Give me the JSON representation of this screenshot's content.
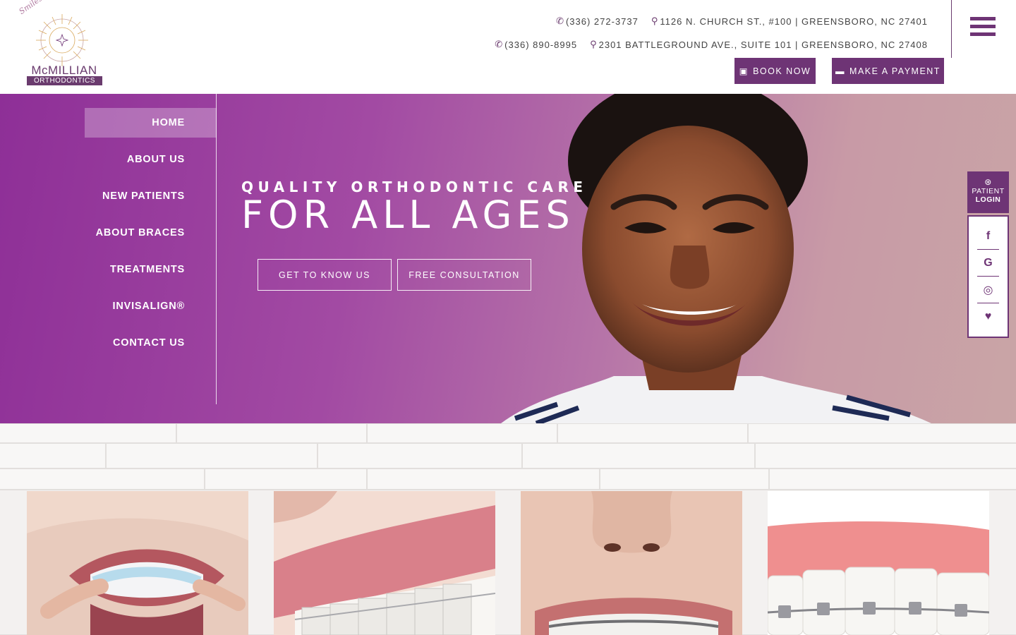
{
  "brand": {
    "tagline": "Smiles for all ages",
    "name": "McMILLIAN",
    "subname": "ORTHODONTICS",
    "accent_color": "#6e3475"
  },
  "contact": {
    "row1": {
      "phone": "(336) 272-3737",
      "address": "1126 N. CHURCH ST., #100 | GREENSBORO, NC 27401"
    },
    "row2": {
      "phone": "(336) 890-8995",
      "address": "2301 BATTLEGROUND AVE., SUITE 101 | GREENSBORO, NC 27408"
    }
  },
  "buttons": {
    "book_now": "BOOK NOW",
    "make_payment": "MAKE A PAYMENT"
  },
  "nav": {
    "items": [
      {
        "label": "HOME",
        "active": true
      },
      {
        "label": "ABOUT US"
      },
      {
        "label": "NEW PATIENTS"
      },
      {
        "label": "ABOUT BRACES"
      },
      {
        "label": "TREATMENTS"
      },
      {
        "label": "INVISALIGN®"
      },
      {
        "label": "CONTACT US"
      }
    ]
  },
  "hero": {
    "eyebrow": "QUALITY ORTHODONTIC CARE",
    "headline": "FOR ALL AGES",
    "cta_primary": "GET TO KNOW US",
    "cta_secondary": "FREE CONSULTATION"
  },
  "patient_login": {
    "line1": "PATIENT",
    "line2": "LOGIN",
    "icon": "user-circle-icon"
  },
  "social": [
    {
      "name": "facebook",
      "glyph": "f"
    },
    {
      "name": "google",
      "glyph": "G"
    },
    {
      "name": "instagram",
      "glyph": "◎"
    },
    {
      "name": "healthgrades",
      "glyph": "♥"
    }
  ],
  "cards": [
    {
      "subject": "clear aligner"
    },
    {
      "subject": "ceramic braces"
    },
    {
      "subject": "metal braces"
    },
    {
      "subject": "metal braces close-up"
    }
  ]
}
